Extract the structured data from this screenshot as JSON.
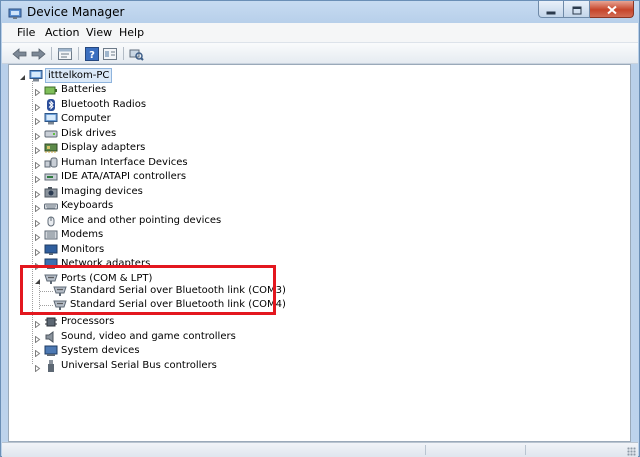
{
  "window": {
    "title": "Device Manager",
    "icon": "device-manager-icon",
    "caption_buttons": [
      "minimize-icon",
      "maximize-icon",
      "close-icon"
    ]
  },
  "menu": {
    "items": [
      "File",
      "Action",
      "View",
      "Help"
    ]
  },
  "toolbar": {
    "buttons": [
      "back-arrow-icon",
      "forward-arrow-icon",
      "properties-icon",
      "help-icon",
      "view-icon",
      "scan-hardware-icon"
    ]
  },
  "tree": {
    "root": "itttelkom-PC",
    "categories": [
      {
        "label": "Batteries",
        "icon": "battery-icon"
      },
      {
        "label": "Bluetooth Radios",
        "icon": "bluetooth-icon"
      },
      {
        "label": "Computer",
        "icon": "computer-icon"
      },
      {
        "label": "Disk drives",
        "icon": "disk-drive-icon"
      },
      {
        "label": "Display adapters",
        "icon": "display-adapter-icon"
      },
      {
        "label": "Human Interface Devices",
        "icon": "hid-icon"
      },
      {
        "label": "IDE ATA/ATAPI controllers",
        "icon": "ide-controller-icon"
      },
      {
        "label": "Imaging devices",
        "icon": "camera-icon"
      },
      {
        "label": "Keyboards",
        "icon": "keyboard-icon"
      },
      {
        "label": "Mice and other pointing devices",
        "icon": "mouse-icon"
      },
      {
        "label": "Modems",
        "icon": "modem-icon"
      },
      {
        "label": "Monitors",
        "icon": "monitor-icon"
      },
      {
        "label": "Network adapters",
        "icon": "network-adapter-icon"
      },
      {
        "label": "Ports (COM & LPT)",
        "icon": "port-icon",
        "expanded": true
      },
      {
        "label": "Processors",
        "icon": "processor-icon"
      },
      {
        "label": "Sound, video and game controllers",
        "icon": "speaker-icon"
      },
      {
        "label": "System devices",
        "icon": "system-device-icon"
      },
      {
        "label": "Universal Serial Bus controllers",
        "icon": "usb-icon"
      }
    ],
    "ports_children": [
      "Standard Serial over Bluetooth link (COM3)",
      "Standard Serial over Bluetooth link (COM4)"
    ]
  },
  "colors": {
    "highlight_border": "#e3171f",
    "title_bar": "#c7dbf1",
    "root_selection": "#dbe9f8"
  }
}
